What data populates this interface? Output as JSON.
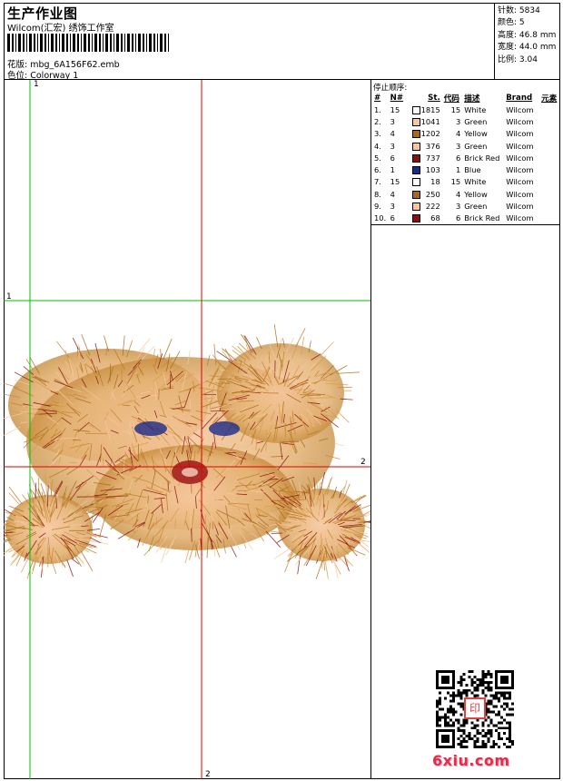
{
  "header": {
    "title": "生产作业图",
    "company": "Wilcom(汇宏) 绣饰工作室",
    "file_label": "花版:",
    "file_name": "mbg_6A156F62.emb",
    "colorway_label": "色位:",
    "colorway": "Colorway 1"
  },
  "stats": [
    {
      "label": "针数:",
      "value": "5834"
    },
    {
      "label": "颜色:",
      "value": "5"
    },
    {
      "label": "高度:",
      "value": "46.8 mm"
    },
    {
      "label": "宽度:",
      "value": "44.0 mm"
    },
    {
      "label": "比例:",
      "value": "3.04"
    }
  ],
  "stop_sequence": {
    "title": "停止顺序:",
    "headers": [
      "#",
      "N#",
      "St.",
      "代码",
      "描述",
      "Brand",
      "元素"
    ],
    "rows": [
      {
        "idx": "1.",
        "n": "15",
        "color": "#ffffff",
        "st": "1815",
        "code": "15",
        "desc": "White",
        "brand": "Wilcom"
      },
      {
        "idx": "2.",
        "n": "3",
        "color": "#f7c79e",
        "st": "1041",
        "code": "3",
        "desc": "Green",
        "brand": "Wilcom"
      },
      {
        "idx": "3.",
        "n": "4",
        "color": "#a86a18",
        "st": "1202",
        "code": "4",
        "desc": "Yellow",
        "brand": "Wilcom"
      },
      {
        "idx": "4.",
        "n": "3",
        "color": "#f7c79e",
        "st": "376",
        "code": "3",
        "desc": "Green",
        "brand": "Wilcom"
      },
      {
        "idx": "5.",
        "n": "6",
        "color": "#8b1010",
        "st": "737",
        "code": "6",
        "desc": "Brick Red",
        "brand": "Wilcom"
      },
      {
        "idx": "6.",
        "n": "1",
        "color": "#1c2a8a",
        "st": "103",
        "code": "1",
        "desc": "Blue",
        "brand": "Wilcom"
      },
      {
        "idx": "7.",
        "n": "15",
        "color": "#ffffff",
        "st": "18",
        "code": "15",
        "desc": "White",
        "brand": "Wilcom"
      },
      {
        "idx": "8.",
        "n": "4",
        "color": "#a86a18",
        "st": "250",
        "code": "4",
        "desc": "Yellow",
        "brand": "Wilcom"
      },
      {
        "idx": "9.",
        "n": "3",
        "color": "#f7c79e",
        "st": "222",
        "code": "3",
        "desc": "Green",
        "brand": "Wilcom"
      },
      {
        "idx": "10.",
        "n": "6",
        "color": "#8b1010",
        "st": "68",
        "code": "6",
        "desc": "Brick Red",
        "brand": "Wilcom"
      }
    ]
  },
  "guides": {
    "v1": "1",
    "h1": "1",
    "v2": "2",
    "h2": "2"
  },
  "watermark": {
    "site": "6xiu.com",
    "seal": "印"
  },
  "colors": {
    "guide_green": "#00c000",
    "guide_red": "#e00000"
  }
}
